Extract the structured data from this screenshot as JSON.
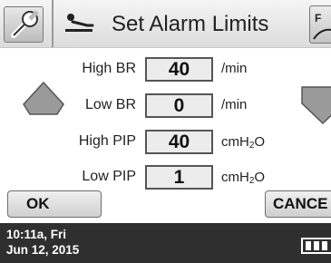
{
  "header": {
    "title": "Set Alarm Limits",
    "tool_icon": "wrench-icon",
    "bed_icon": "patient-bed-icon",
    "cut_button_label": "F"
  },
  "rows": [
    {
      "label": "High BR",
      "value": "40",
      "unit": "/min"
    },
    {
      "label": "Low BR",
      "value": "0",
      "unit": "/min"
    },
    {
      "label": "High PIP",
      "value": "40",
      "unit_main": "cmH",
      "unit_sub": "2",
      "unit_tail": "O"
    },
    {
      "label": "Low PIP",
      "value": "1",
      "unit_main": "cmH",
      "unit_sub": "2",
      "unit_tail": "O"
    }
  ],
  "arrows": {
    "up": "arrow-up-icon",
    "down": "arrow-down-icon"
  },
  "buttons": {
    "ok": "OK",
    "cancel": "CANCE"
  },
  "status": {
    "time": "10:11a, Fri",
    "date": "Jun 12, 2015",
    "battery_icon": "battery-icon"
  },
  "colors": {
    "status_bar": "#2f2f2f",
    "arrow_fill": "#9a9a9a",
    "header_bg": "#e6e6e6"
  }
}
